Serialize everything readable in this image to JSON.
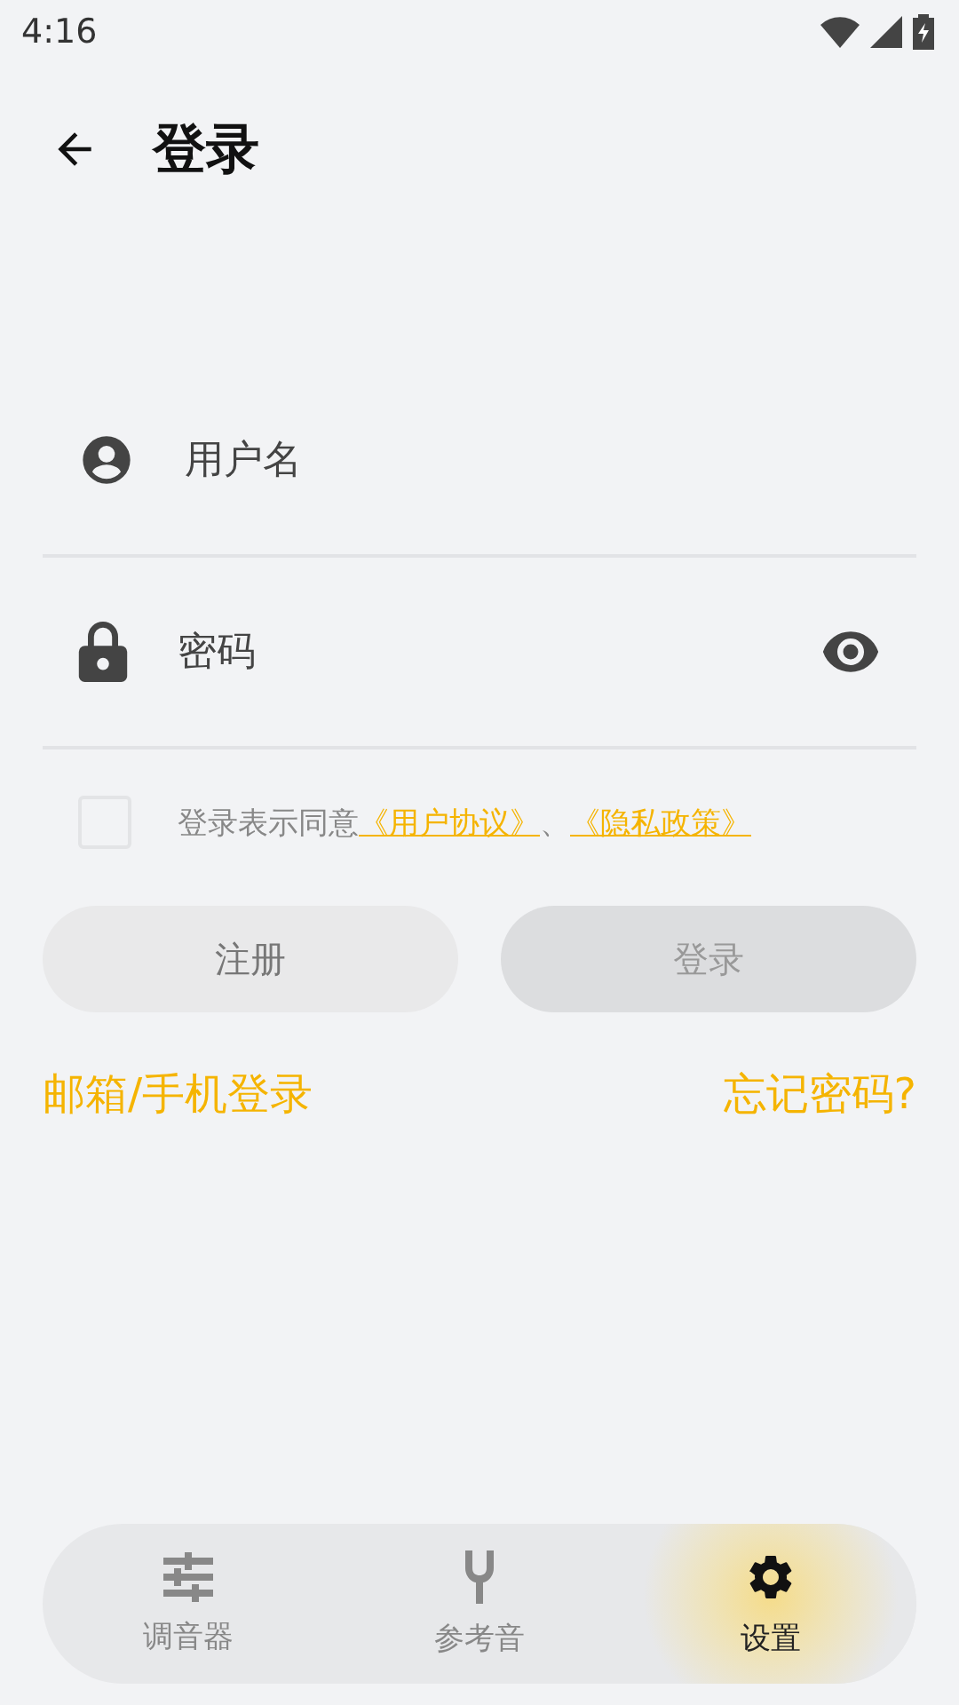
{
  "status_bar": {
    "time": "4:16"
  },
  "header": {
    "title": "登录"
  },
  "fields": [
    {
      "kind": "user",
      "placeholder": "用户名"
    },
    {
      "kind": "password",
      "placeholder": "密码"
    }
  ],
  "agreement": {
    "checked": false,
    "text": "登录表示同意",
    "links": [
      "《用户协议》",
      "《隐私政策》"
    ],
    "separator": "、"
  },
  "buttons": [
    {
      "label": "注册",
      "kind": "secondary"
    },
    {
      "label": "登录",
      "kind": "primary",
      "disabled": true
    }
  ],
  "links": [
    "邮箱/手机登录",
    "忘记密码?"
  ],
  "nav": [
    {
      "label": "调音器",
      "kind": "sliders",
      "selected": false
    },
    {
      "label": "参考音",
      "kind": "fork",
      "selected": false
    },
    {
      "label": "设置",
      "kind": "gear",
      "selected": true
    }
  ]
}
